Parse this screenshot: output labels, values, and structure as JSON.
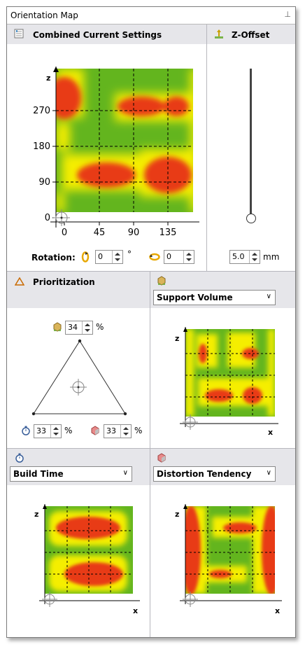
{
  "window": {
    "title": "Orientation Map",
    "pin_glyph": "⊥"
  },
  "combined": {
    "title": "Combined Current Settings",
    "axis_z": "z",
    "y_ticks": [
      "270",
      "180",
      "90",
      "0"
    ],
    "x_ticks": [
      "0",
      "45",
      "90",
      "135"
    ]
  },
  "rotation": {
    "label": "Rotation:",
    "value1": "0",
    "unit1": "°",
    "value2": "0"
  },
  "zoffset": {
    "title": "Z-Offset",
    "value": "5.0",
    "unit": "mm",
    "level": 0.0
  },
  "prioritization": {
    "title": "Prioritization",
    "top_value": "34",
    "left_value": "33",
    "right_value": "33",
    "unit": "%"
  },
  "support": {
    "dropdown": "Support Volume",
    "axis_z": "z",
    "axis_x": "x"
  },
  "buildtime": {
    "dropdown": "Build Time",
    "axis_z": "z",
    "axis_x": "x"
  },
  "distortion": {
    "dropdown": "Distortion Tendency",
    "axis_z": "z",
    "axis_x": "x"
  },
  "colors": {
    "high": "#e83a12",
    "mid": "#f5ee00",
    "low": "#63b51e",
    "header_bg": "#e6e6ea"
  }
}
